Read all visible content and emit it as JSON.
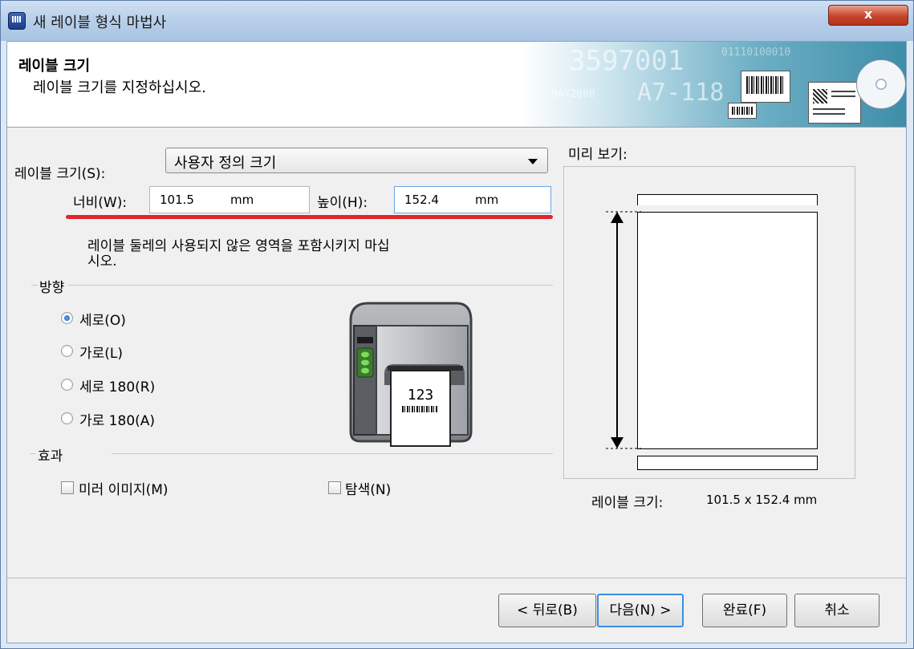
{
  "window": {
    "title": "새 레이블 형식 마법사",
    "close_glyph": "x"
  },
  "header": {
    "title": "레이블 크기",
    "subtitle": "레이블 크기를 지정하십시오.",
    "art_number": "3597001",
    "art_code": "A7-118",
    "art_small": "9AY2000",
    "art_bits": "01110100010"
  },
  "size": {
    "label": "레이블 크기(S):",
    "selected": "사용자 정의 크기"
  },
  "width": {
    "label": "너비(W):",
    "value": "101.5",
    "unit": "mm"
  },
  "height": {
    "label": "높이(H):",
    "value": "152.4",
    "unit": "mm"
  },
  "note": {
    "line1": "레이블 둘레의 사용되지 않은 영역을 포함시키지 마십",
    "line2": "시오."
  },
  "orientation": {
    "group": "방향",
    "options": [
      {
        "label": "세로(O)",
        "selected": true
      },
      {
        "label": "가로(L)",
        "selected": false
      },
      {
        "label": "세로 180(R)",
        "selected": false
      },
      {
        "label": "가로 180(A)",
        "selected": false
      }
    ]
  },
  "printer_label": {
    "number": "123"
  },
  "effects": {
    "group": "효과",
    "mirror": "미러 이미지(M)",
    "mirror_checked": false,
    "search": "탐색(N)",
    "search_checked": false
  },
  "preview": {
    "title": "미리 보기:",
    "size_label": "레이블 크기:",
    "size_value": "101.5 x 152.4 mm"
  },
  "buttons": {
    "back": "< 뒤로(B)",
    "next": "다음(N) >",
    "finish": "완료(F)",
    "cancel": "취소"
  },
  "colors": {
    "accent_underline": "#e2262b",
    "focus_border": "#3a8ee6"
  }
}
